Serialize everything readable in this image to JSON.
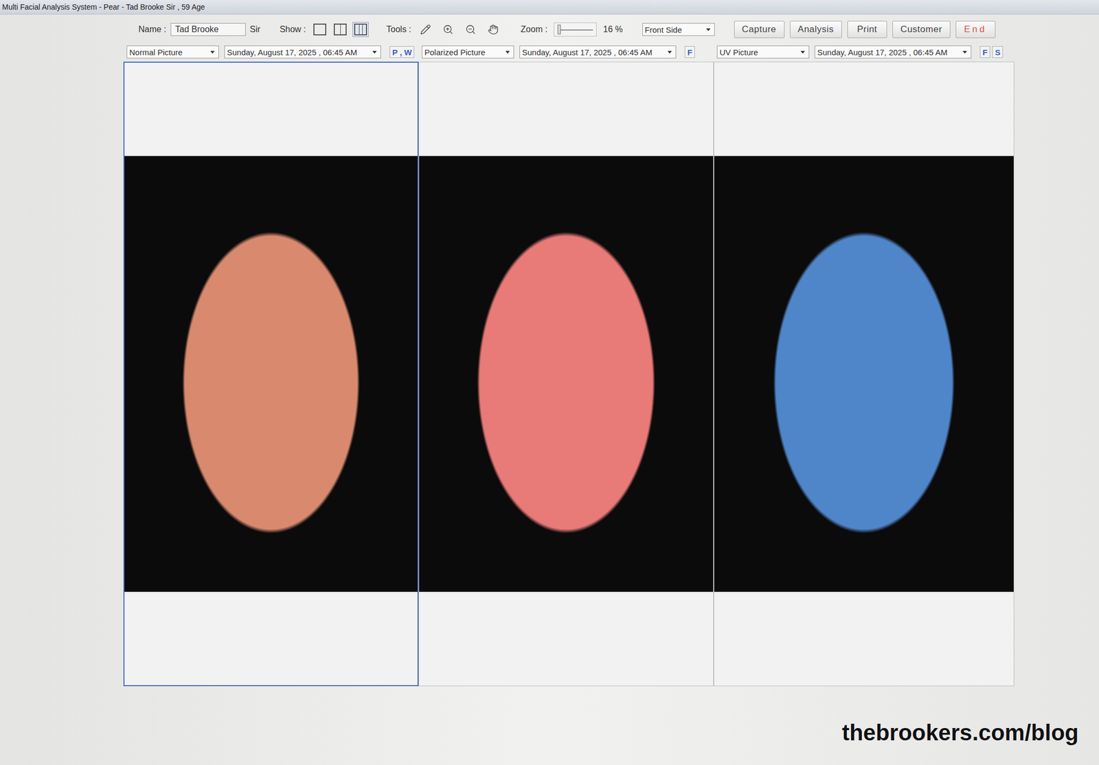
{
  "window": {
    "title": "Multi Facial Analysis System - Pear - Tad Brooke Sir , 59 Age"
  },
  "toolbar": {
    "name_label": "Name :",
    "name_value": "Tad Brooke",
    "honorific": "Sir",
    "show_label": "Show :",
    "layouts": [
      {
        "kind": "single",
        "selected": false
      },
      {
        "kind": "double",
        "selected": false
      },
      {
        "kind": "triple",
        "selected": true
      }
    ],
    "tools_label": "Tools :",
    "tools": [
      {
        "kind": "pen"
      },
      {
        "kind": "zoom-in"
      },
      {
        "kind": "zoom-out"
      },
      {
        "kind": "hand"
      }
    ],
    "zoom_label": "Zoom :",
    "zoom": {
      "level": 0.05,
      "reading": "16 %"
    },
    "view": "Front Side",
    "buttons": [
      {
        "label": "Capture",
        "kind": "normal"
      },
      {
        "label": "Analysis",
        "kind": "normal"
      },
      {
        "label": "Print",
        "kind": "normal"
      },
      {
        "label": "Customer",
        "kind": "normal"
      },
      {
        "label": "End",
        "kind": "danger"
      }
    ]
  },
  "panels": [
    {
      "type": "Normal Picture",
      "date": "Sunday, August 17, 2025 , 06:45 AM",
      "flags": [
        "P , W"
      ],
      "selected": true,
      "color": "#d98a6e"
    },
    {
      "type": "Polarized Picture",
      "date": "Sunday, August 17, 2025 , 06:45 AM",
      "flags": [
        "F"
      ],
      "selected": false,
      "color": "#e87a78"
    },
    {
      "type": "UV Picture",
      "date": "Sunday, August 17, 2025 , 06:45 AM",
      "flags": [
        "F",
        "S"
      ],
      "selected": false,
      "color": "#4f86c9"
    }
  ],
  "watermark": "thebrookers.com/blog"
}
